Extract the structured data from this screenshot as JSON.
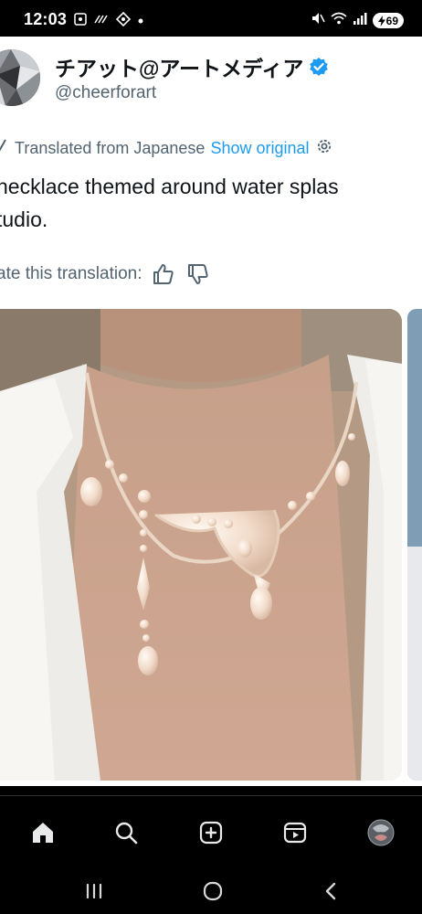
{
  "status_bar": {
    "time": "12:03",
    "battery": "69",
    "left_icons": [
      "screenshot-icon",
      "wifi-calling-icon",
      "vpn-icon",
      "notification-dot-icon"
    ],
    "right_icons": [
      "mute-icon",
      "wifi-icon",
      "signal-icon",
      "battery-icon"
    ]
  },
  "tweet": {
    "display_name": "チアット@アートメディア",
    "handle": "@cheerforart",
    "translated_label": "Translated from Japanese",
    "show_original": "Show original",
    "text_line1": "necklace themed around water splas",
    "text_line2": "tudio.",
    "rate_label": "ate this translation:"
  },
  "bottom_nav": {
    "items": [
      "home-icon",
      "search-icon",
      "compose-icon",
      "video-icon",
      "profile-avatar"
    ]
  },
  "colors": {
    "accent": "#1d9bf0",
    "text": "#0f1419",
    "muted": "#536471"
  }
}
